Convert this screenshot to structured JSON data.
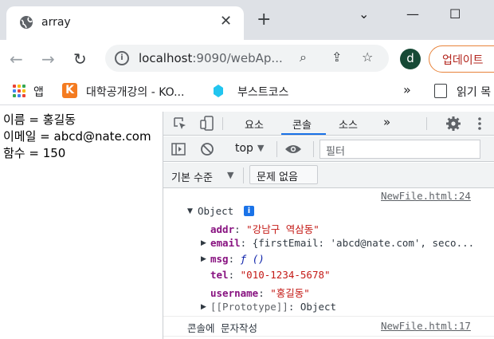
{
  "browser": {
    "tab_title": "array",
    "close_glyph": "✕",
    "new_tab_glyph": "+",
    "window_controls": [
      "⌄",
      "—",
      "☐"
    ],
    "url_host": "localhost",
    "url_rest": ":9090/webAp...",
    "profile_initial": "d",
    "update_label": "업데이트",
    "nav": {
      "back": "←",
      "forward": "→",
      "reload": "↻"
    },
    "omni_icons": {
      "search": "⌕",
      "share": "⇪",
      "star": "☆"
    }
  },
  "bookmarks": {
    "apps_label": "앱",
    "items": [
      "대학공개강의 - KO...",
      "부스트코스"
    ],
    "overflow": "»",
    "reading_list": "읽기 목"
  },
  "page": {
    "lines": [
      "이름 = 홍길동",
      "이메일 = abcd@nate.com",
      "함수 = 150"
    ]
  },
  "devtools": {
    "tabs": [
      "요소",
      "콘솔",
      "소스",
      "»"
    ],
    "active_tab": "콘솔",
    "context": "top",
    "filter_placeholder": "필터",
    "levels_label": "기본 수준",
    "issues_label": "문제 없음",
    "log": [
      {
        "source": "NewFile.html:24"
      },
      {
        "source": "NewFile.html:17",
        "message": "콘솔에 문자작성"
      }
    ],
    "object": {
      "label": "Object",
      "info_glyph": "i",
      "props": [
        {
          "key": "addr",
          "sep": ": ",
          "value": "\"강남구 역삼동\""
        },
        {
          "key": "email",
          "sep": ": ",
          "value": "{firstEmail: 'abcd@nate.com', seco..."
        },
        {
          "key": "msg",
          "sep": ": ",
          "value": "ƒ ()"
        },
        {
          "key": "tel",
          "sep": ": ",
          "value": "\"010-1234-5678\""
        },
        {
          "key": "username",
          "sep": ": ",
          "value": "\"홍길동\""
        },
        {
          "key": "[[Prototype]]",
          "sep": ": ",
          "value": "Object"
        }
      ]
    }
  }
}
